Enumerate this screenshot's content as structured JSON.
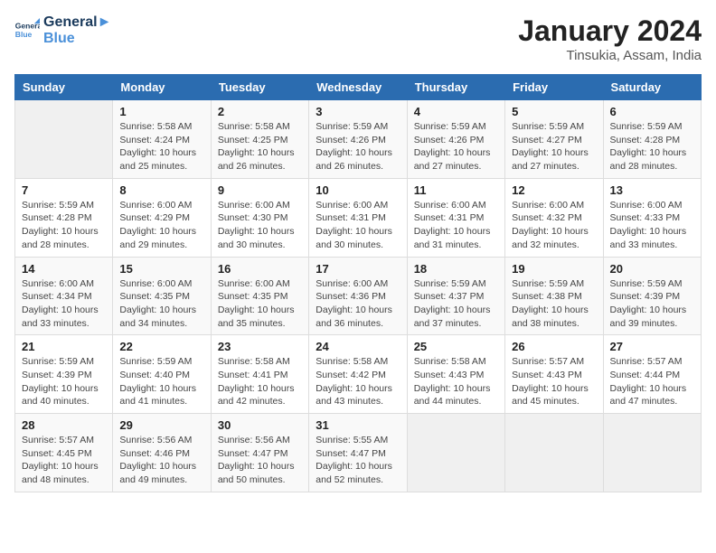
{
  "header": {
    "logo_line1": "General",
    "logo_line2": "Blue",
    "month_year": "January 2024",
    "location": "Tinsukia, Assam, India"
  },
  "weekdays": [
    "Sunday",
    "Monday",
    "Tuesday",
    "Wednesday",
    "Thursday",
    "Friday",
    "Saturday"
  ],
  "weeks": [
    [
      {
        "day": "",
        "info": ""
      },
      {
        "day": "1",
        "info": "Sunrise: 5:58 AM\nSunset: 4:24 PM\nDaylight: 10 hours\nand 25 minutes."
      },
      {
        "day": "2",
        "info": "Sunrise: 5:58 AM\nSunset: 4:25 PM\nDaylight: 10 hours\nand 26 minutes."
      },
      {
        "day": "3",
        "info": "Sunrise: 5:59 AM\nSunset: 4:26 PM\nDaylight: 10 hours\nand 26 minutes."
      },
      {
        "day": "4",
        "info": "Sunrise: 5:59 AM\nSunset: 4:26 PM\nDaylight: 10 hours\nand 27 minutes."
      },
      {
        "day": "5",
        "info": "Sunrise: 5:59 AM\nSunset: 4:27 PM\nDaylight: 10 hours\nand 27 minutes."
      },
      {
        "day": "6",
        "info": "Sunrise: 5:59 AM\nSunset: 4:28 PM\nDaylight: 10 hours\nand 28 minutes."
      }
    ],
    [
      {
        "day": "7",
        "info": "Sunrise: 5:59 AM\nSunset: 4:28 PM\nDaylight: 10 hours\nand 28 minutes."
      },
      {
        "day": "8",
        "info": "Sunrise: 6:00 AM\nSunset: 4:29 PM\nDaylight: 10 hours\nand 29 minutes."
      },
      {
        "day": "9",
        "info": "Sunrise: 6:00 AM\nSunset: 4:30 PM\nDaylight: 10 hours\nand 30 minutes."
      },
      {
        "day": "10",
        "info": "Sunrise: 6:00 AM\nSunset: 4:31 PM\nDaylight: 10 hours\nand 30 minutes."
      },
      {
        "day": "11",
        "info": "Sunrise: 6:00 AM\nSunset: 4:31 PM\nDaylight: 10 hours\nand 31 minutes."
      },
      {
        "day": "12",
        "info": "Sunrise: 6:00 AM\nSunset: 4:32 PM\nDaylight: 10 hours\nand 32 minutes."
      },
      {
        "day": "13",
        "info": "Sunrise: 6:00 AM\nSunset: 4:33 PM\nDaylight: 10 hours\nand 33 minutes."
      }
    ],
    [
      {
        "day": "14",
        "info": "Sunrise: 6:00 AM\nSunset: 4:34 PM\nDaylight: 10 hours\nand 33 minutes."
      },
      {
        "day": "15",
        "info": "Sunrise: 6:00 AM\nSunset: 4:35 PM\nDaylight: 10 hours\nand 34 minutes."
      },
      {
        "day": "16",
        "info": "Sunrise: 6:00 AM\nSunset: 4:35 PM\nDaylight: 10 hours\nand 35 minutes."
      },
      {
        "day": "17",
        "info": "Sunrise: 6:00 AM\nSunset: 4:36 PM\nDaylight: 10 hours\nand 36 minutes."
      },
      {
        "day": "18",
        "info": "Sunrise: 5:59 AM\nSunset: 4:37 PM\nDaylight: 10 hours\nand 37 minutes."
      },
      {
        "day": "19",
        "info": "Sunrise: 5:59 AM\nSunset: 4:38 PM\nDaylight: 10 hours\nand 38 minutes."
      },
      {
        "day": "20",
        "info": "Sunrise: 5:59 AM\nSunset: 4:39 PM\nDaylight: 10 hours\nand 39 minutes."
      }
    ],
    [
      {
        "day": "21",
        "info": "Sunrise: 5:59 AM\nSunset: 4:39 PM\nDaylight: 10 hours\nand 40 minutes."
      },
      {
        "day": "22",
        "info": "Sunrise: 5:59 AM\nSunset: 4:40 PM\nDaylight: 10 hours\nand 41 minutes."
      },
      {
        "day": "23",
        "info": "Sunrise: 5:58 AM\nSunset: 4:41 PM\nDaylight: 10 hours\nand 42 minutes."
      },
      {
        "day": "24",
        "info": "Sunrise: 5:58 AM\nSunset: 4:42 PM\nDaylight: 10 hours\nand 43 minutes."
      },
      {
        "day": "25",
        "info": "Sunrise: 5:58 AM\nSunset: 4:43 PM\nDaylight: 10 hours\nand 44 minutes."
      },
      {
        "day": "26",
        "info": "Sunrise: 5:57 AM\nSunset: 4:43 PM\nDaylight: 10 hours\nand 45 minutes."
      },
      {
        "day": "27",
        "info": "Sunrise: 5:57 AM\nSunset: 4:44 PM\nDaylight: 10 hours\nand 47 minutes."
      }
    ],
    [
      {
        "day": "28",
        "info": "Sunrise: 5:57 AM\nSunset: 4:45 PM\nDaylight: 10 hours\nand 48 minutes."
      },
      {
        "day": "29",
        "info": "Sunrise: 5:56 AM\nSunset: 4:46 PM\nDaylight: 10 hours\nand 49 minutes."
      },
      {
        "day": "30",
        "info": "Sunrise: 5:56 AM\nSunset: 4:47 PM\nDaylight: 10 hours\nand 50 minutes."
      },
      {
        "day": "31",
        "info": "Sunrise: 5:55 AM\nSunset: 4:47 PM\nDaylight: 10 hours\nand 52 minutes."
      },
      {
        "day": "",
        "info": ""
      },
      {
        "day": "",
        "info": ""
      },
      {
        "day": "",
        "info": ""
      }
    ]
  ]
}
